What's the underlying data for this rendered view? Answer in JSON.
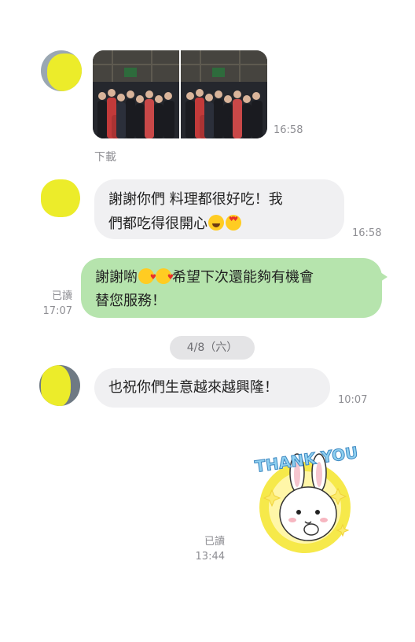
{
  "messages": [
    {
      "type": "image",
      "time": "16:58",
      "download_label": "下載"
    },
    {
      "type": "text",
      "line1": "謝謝你們 料理都很好吃！我",
      "line2": "們都吃得很開心",
      "time": "16:58",
      "emojis": [
        "smile-emoji",
        "heart-eyes-emoji"
      ]
    },
    {
      "type": "text",
      "line1": "謝謝喲",
      "line1_after": "希望下次還能夠有機會",
      "line2": "替您服務！",
      "read_label": "已讀",
      "time": "17:07",
      "emojis": [
        "smiling-face-hearts-emoji",
        "smiling-face-hearts-emoji"
      ]
    },
    {
      "type": "text",
      "text": "也祝你們生意越來越興隆！",
      "time": "10:07"
    },
    {
      "type": "sticker",
      "sticker_text": "THANK YOU",
      "read_label": "已讀",
      "time": "13:44"
    }
  ],
  "date_separator": "4/8（六）",
  "colors": {
    "outgoing_bubble": "#b6e4ad",
    "incoming_bubble": "#f0f0f2",
    "meta_text": "#8e8e93"
  }
}
